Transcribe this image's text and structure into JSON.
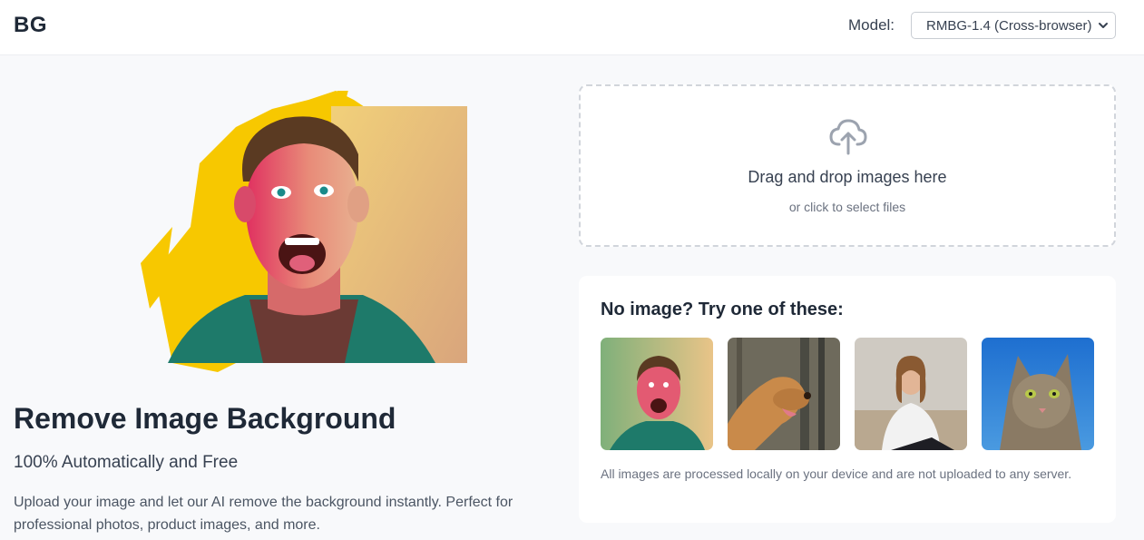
{
  "header": {
    "logo": "BG",
    "model_label": "Model:",
    "model_selected": "RMBG-1.4 (Cross-browser)"
  },
  "hero": {
    "title": "Remove Image Background",
    "subtitle": "100% Automatically and Free",
    "description": "Upload your image and let our AI remove the background instantly. Perfect for professional photos, product images, and more."
  },
  "dropzone": {
    "title": "Drag and drop images here",
    "subtitle": "or click to select files",
    "icon": "cloud-upload-icon"
  },
  "samples": {
    "title": "No image? Try one of these:",
    "items": [
      {
        "name": "sample-man"
      },
      {
        "name": "sample-dog"
      },
      {
        "name": "sample-woman"
      },
      {
        "name": "sample-cat"
      }
    ],
    "note": "All images are processed locally on your device and are not uploaded to any server."
  },
  "colors": {
    "accent_yellow": "#f7c800",
    "text_dark": "#1f2937",
    "page_bg": "#f8f9fb"
  }
}
